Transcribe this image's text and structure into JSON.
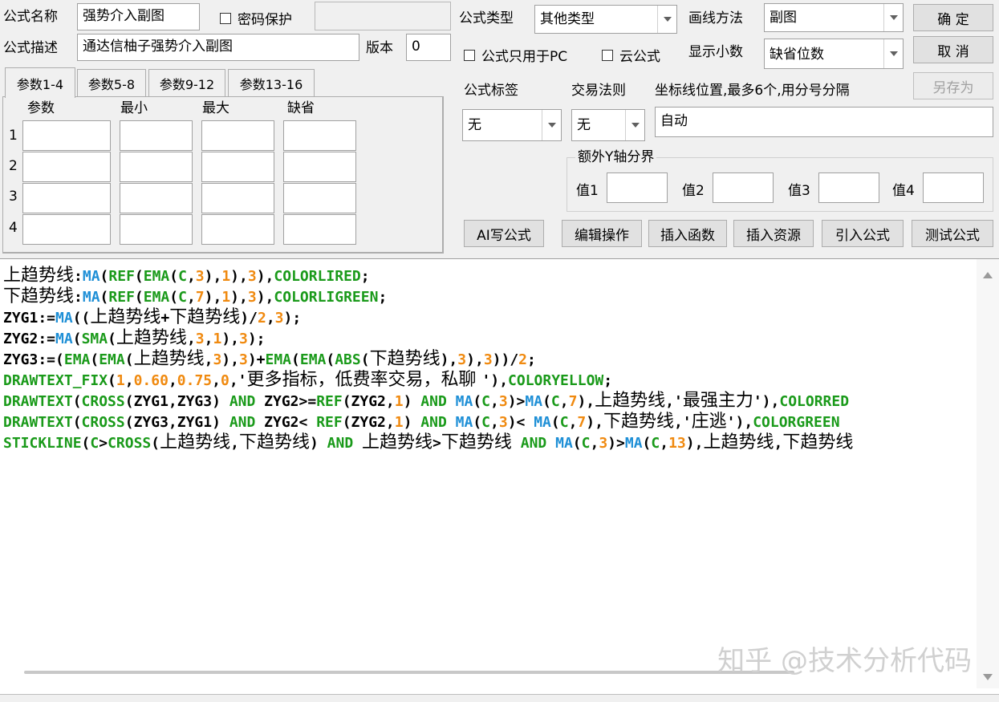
{
  "formula": {
    "name_label": "公式名称",
    "name_value": "强势介入副图",
    "password_label": "密码保护",
    "password_value": "",
    "desc_label": "公式描述",
    "desc_value": "通达信柚子强势介入副图",
    "version_label": "版本",
    "version_value": "0",
    "type_label": "公式类型",
    "type_value": "其他类型",
    "draw_label": "画线方法",
    "draw_value": "副图",
    "pc_only_label": "公式只用于PC",
    "cloud_label": "云公式",
    "decimals_label": "显示小数",
    "decimals_value": "缺省位数",
    "tag_label": "公式标签",
    "tag_value": "无",
    "rule_label": "交易法则",
    "rule_value": "无",
    "axis_label": "坐标线位置,最多6个,用分号分隔",
    "axis_value": "自动"
  },
  "buttons": {
    "ok": "确 定",
    "cancel": "取 消",
    "save_as": "另存为",
    "ai": "AI写公式",
    "edit": "编辑操作",
    "insert_fn": "插入函数",
    "insert_res": "插入资源",
    "import": "引入公式",
    "test": "测试公式"
  },
  "tabs": [
    "参数1-4",
    "参数5-8",
    "参数9-12",
    "参数13-16"
  ],
  "params": {
    "headers": [
      "参数",
      "最小",
      "最大",
      "缺省"
    ],
    "rows": [
      "1",
      "2",
      "3",
      "4"
    ]
  },
  "yaxis": {
    "title": "额外Y轴分界",
    "v1": "值1",
    "v2": "值2",
    "v3": "值3",
    "v4": "值4"
  },
  "watermark": "知乎 @技术分析代码",
  "code_lines": [
    [
      [
        "k-blk",
        "上趋势线"
      ],
      [
        "k-punct",
        ":"
      ],
      [
        "k-fn1",
        "MA"
      ],
      [
        "k-punct",
        "("
      ],
      [
        "k-fn2",
        "REF"
      ],
      [
        "k-punct",
        "("
      ],
      [
        "k-fn2",
        "EMA"
      ],
      [
        "k-punct",
        "("
      ],
      [
        "k-fn2",
        "C"
      ],
      [
        "k-punct",
        ","
      ],
      [
        "k-num",
        "3"
      ],
      [
        "k-punct",
        "),"
      ],
      [
        "k-num",
        "1"
      ],
      [
        "k-punct",
        "),"
      ],
      [
        "k-num",
        "3"
      ],
      [
        "k-punct",
        "),"
      ],
      [
        "k-fn2",
        "COLORLIRED"
      ],
      [
        "k-punct",
        ";"
      ]
    ],
    [
      [
        "k-blk",
        "下趋势线"
      ],
      [
        "k-punct",
        ":"
      ],
      [
        "k-fn1",
        "MA"
      ],
      [
        "k-punct",
        "("
      ],
      [
        "k-fn2",
        "REF"
      ],
      [
        "k-punct",
        "("
      ],
      [
        "k-fn2",
        "EMA"
      ],
      [
        "k-punct",
        "("
      ],
      [
        "k-fn2",
        "C"
      ],
      [
        "k-punct",
        ","
      ],
      [
        "k-num",
        "7"
      ],
      [
        "k-punct",
        "),"
      ],
      [
        "k-num",
        "1"
      ],
      [
        "k-punct",
        "),"
      ],
      [
        "k-num",
        "3"
      ],
      [
        "k-punct",
        "),"
      ],
      [
        "k-fn2",
        "COLORLIGREEN"
      ],
      [
        "k-punct",
        ";"
      ]
    ],
    [
      [
        "k-var",
        "ZYG1:="
      ],
      [
        "k-fn1",
        "MA"
      ],
      [
        "k-punct",
        "(("
      ],
      [
        "k-blk",
        "上趋势线"
      ],
      [
        "k-punct",
        "+"
      ],
      [
        "k-blk",
        "下趋势线"
      ],
      [
        "k-punct",
        ")/"
      ],
      [
        "k-num",
        "2"
      ],
      [
        "k-punct",
        ","
      ],
      [
        "k-num",
        "3"
      ],
      [
        "k-punct",
        ");"
      ]
    ],
    [
      [
        "k-var",
        "ZYG2:="
      ],
      [
        "k-fn1",
        "MA"
      ],
      [
        "k-punct",
        "("
      ],
      [
        "k-fn2",
        "SMA"
      ],
      [
        "k-punct",
        "("
      ],
      [
        "k-blk",
        "上趋势线"
      ],
      [
        "k-punct",
        ","
      ],
      [
        "k-num",
        "3"
      ],
      [
        "k-punct",
        ","
      ],
      [
        "k-num",
        "1"
      ],
      [
        "k-punct",
        "),"
      ],
      [
        "k-num",
        "3"
      ],
      [
        "k-punct",
        ");"
      ]
    ],
    [
      [
        "k-var",
        "ZYG3:=("
      ],
      [
        "k-fn2",
        "EMA"
      ],
      [
        "k-punct",
        "("
      ],
      [
        "k-fn2",
        "EMA"
      ],
      [
        "k-punct",
        "("
      ],
      [
        "k-blk",
        "上趋势线"
      ],
      [
        "k-punct",
        ","
      ],
      [
        "k-num",
        "3"
      ],
      [
        "k-punct",
        "),"
      ],
      [
        "k-num",
        "3"
      ],
      [
        "k-punct",
        ")+"
      ],
      [
        "k-fn2",
        "EMA"
      ],
      [
        "k-punct",
        "("
      ],
      [
        "k-fn2",
        "EMA"
      ],
      [
        "k-punct",
        "("
      ],
      [
        "k-fn2",
        "ABS"
      ],
      [
        "k-punct",
        "("
      ],
      [
        "k-blk",
        "下趋势线"
      ],
      [
        "k-punct",
        "),"
      ],
      [
        "k-num",
        "3"
      ],
      [
        "k-punct",
        "),"
      ],
      [
        "k-num",
        "3"
      ],
      [
        "k-punct",
        "))/"
      ],
      [
        "k-num",
        "2"
      ],
      [
        "k-punct",
        ";"
      ]
    ],
    [
      [
        "k-fn2",
        "DRAWTEXT_FIX"
      ],
      [
        "k-punct",
        "("
      ],
      [
        "k-num",
        "1"
      ],
      [
        "k-punct",
        ","
      ],
      [
        "k-num",
        "0.60"
      ],
      [
        "k-punct",
        ","
      ],
      [
        "k-num",
        "0.75"
      ],
      [
        "k-punct",
        ","
      ],
      [
        "k-num",
        "0"
      ],
      [
        "k-punct",
        ",'"
      ],
      [
        "k-str",
        "更多指标，低费率交易，私聊 "
      ],
      [
        "k-punct",
        "'),"
      ],
      [
        "k-fn2",
        "COLORYELLOW"
      ],
      [
        "k-punct",
        ";"
      ]
    ],
    [
      [
        "k-fn2",
        "DRAWTEXT"
      ],
      [
        "k-punct",
        "("
      ],
      [
        "k-fn2",
        "CROSS"
      ],
      [
        "k-punct",
        "("
      ],
      [
        "k-var",
        "ZYG1,ZYG3"
      ],
      [
        "k-punct",
        ") "
      ],
      [
        "k-fn2",
        "AND"
      ],
      [
        "k-var",
        " ZYG2>="
      ],
      [
        "k-fn2",
        "REF"
      ],
      [
        "k-punct",
        "("
      ],
      [
        "k-var",
        "ZYG2,"
      ],
      [
        "k-num",
        "1"
      ],
      [
        "k-punct",
        ") "
      ],
      [
        "k-fn2",
        "AND"
      ],
      [
        "k-punct",
        " "
      ],
      [
        "k-fn1",
        "MA"
      ],
      [
        "k-punct",
        "("
      ],
      [
        "k-fn2",
        "C"
      ],
      [
        "k-punct",
        ","
      ],
      [
        "k-num",
        "3"
      ],
      [
        "k-punct",
        ")>"
      ],
      [
        "k-fn1",
        "MA"
      ],
      [
        "k-punct",
        "("
      ],
      [
        "k-fn2",
        "C"
      ],
      [
        "k-punct",
        ","
      ],
      [
        "k-num",
        "7"
      ],
      [
        "k-punct",
        "),"
      ],
      [
        "k-blk",
        "上趋势线"
      ],
      [
        "k-punct",
        ",'"
      ],
      [
        "k-str",
        "最强主力"
      ],
      [
        "k-punct",
        "'),"
      ],
      [
        "k-fn2",
        "COLORRED"
      ]
    ],
    [
      [
        "k-fn2",
        "DRAWTEXT"
      ],
      [
        "k-punct",
        "("
      ],
      [
        "k-fn2",
        "CROSS"
      ],
      [
        "k-punct",
        "("
      ],
      [
        "k-var",
        "ZYG3,ZYG1"
      ],
      [
        "k-punct",
        ") "
      ],
      [
        "k-fn2",
        "AND"
      ],
      [
        "k-var",
        " ZYG2< "
      ],
      [
        "k-fn2",
        "REF"
      ],
      [
        "k-punct",
        "("
      ],
      [
        "k-var",
        "ZYG2,"
      ],
      [
        "k-num",
        "1"
      ],
      [
        "k-punct",
        ") "
      ],
      [
        "k-fn2",
        "AND"
      ],
      [
        "k-punct",
        " "
      ],
      [
        "k-fn1",
        "MA"
      ],
      [
        "k-punct",
        "("
      ],
      [
        "k-fn2",
        "C"
      ],
      [
        "k-punct",
        ","
      ],
      [
        "k-num",
        "3"
      ],
      [
        "k-punct",
        ")< "
      ],
      [
        "k-fn1",
        "MA"
      ],
      [
        "k-punct",
        "("
      ],
      [
        "k-fn2",
        "C"
      ],
      [
        "k-punct",
        ","
      ],
      [
        "k-num",
        "7"
      ],
      [
        "k-punct",
        "),"
      ],
      [
        "k-blk",
        "下趋势线"
      ],
      [
        "k-punct",
        ",'"
      ],
      [
        "k-str",
        "庄逃"
      ],
      [
        "k-punct",
        "'),"
      ],
      [
        "k-fn2",
        "COLORGREEN"
      ]
    ],
    [
      [
        "k-fn2",
        "STICKLINE"
      ],
      [
        "k-punct",
        "("
      ],
      [
        "k-fn2",
        "C"
      ],
      [
        "k-punct",
        ">"
      ],
      [
        "k-fn2",
        "CROSS"
      ],
      [
        "k-punct",
        "("
      ],
      [
        "k-blk",
        "上趋势线"
      ],
      [
        "k-punct",
        ","
      ],
      [
        "k-blk",
        "下趋势线"
      ],
      [
        "k-punct",
        ") "
      ],
      [
        "k-fn2",
        "AND"
      ],
      [
        "k-punct",
        " "
      ],
      [
        "k-blk",
        "上趋势线"
      ],
      [
        "k-punct",
        ">"
      ],
      [
        "k-blk",
        "下趋势线"
      ],
      [
        "k-punct",
        " "
      ],
      [
        "k-fn2",
        "AND"
      ],
      [
        "k-punct",
        " "
      ],
      [
        "k-fn1",
        "MA"
      ],
      [
        "k-punct",
        "("
      ],
      [
        "k-fn2",
        "C"
      ],
      [
        "k-punct",
        ","
      ],
      [
        "k-num",
        "3"
      ],
      [
        "k-punct",
        ")>"
      ],
      [
        "k-fn1",
        "MA"
      ],
      [
        "k-punct",
        "("
      ],
      [
        "k-fn2",
        "C"
      ],
      [
        "k-punct",
        ","
      ],
      [
        "k-num",
        "13"
      ],
      [
        "k-punct",
        "),"
      ],
      [
        "k-blk",
        "上趋势线"
      ],
      [
        "k-punct",
        ","
      ],
      [
        "k-blk",
        "下趋势线"
      ]
    ]
  ]
}
